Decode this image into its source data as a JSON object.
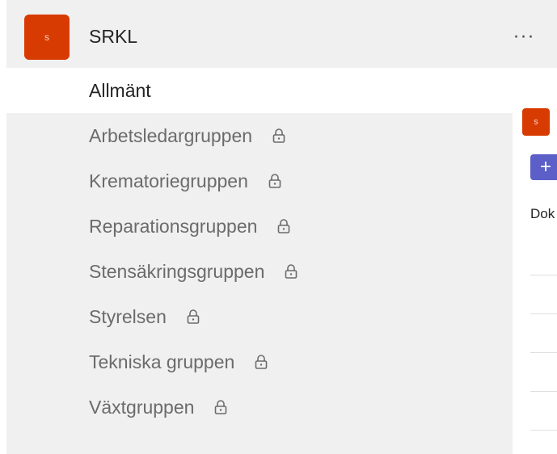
{
  "team": {
    "avatar_letter": "s",
    "name": "SRKL",
    "more_label": "···"
  },
  "channels": [
    {
      "label": "Allmänt",
      "private": false,
      "selected": true
    },
    {
      "label": "Arbetsledargruppen",
      "private": true
    },
    {
      "label": "Krematoriegruppen",
      "private": true
    },
    {
      "label": "Reparationsgruppen",
      "private": true
    },
    {
      "label": "Stensäkringsgruppen",
      "private": true
    },
    {
      "label": "Styrelsen",
      "private": true
    },
    {
      "label": "Tekniska gruppen",
      "private": true
    },
    {
      "label": "Växtgruppen",
      "private": true
    }
  ],
  "side_pane": {
    "avatar_letter": "s",
    "add_label": "+",
    "doc_label": "Dok"
  },
  "colors": {
    "brand": "#d83b01",
    "accent": "#5b5fc7",
    "sidebar_bg": "#f0f0f0"
  }
}
